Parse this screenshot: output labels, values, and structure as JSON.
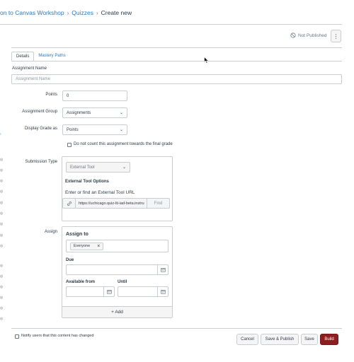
{
  "breadcrumb": {
    "course": "on to Canvas Workshop",
    "section": "Quizzes",
    "current": "Create new",
    "separator": "›"
  },
  "header": {
    "status": "Not Published",
    "menu_glyph": "⋮"
  },
  "tabs": [
    {
      "label": "Details",
      "active": true
    },
    {
      "label": "Mastery Paths",
      "active": false
    }
  ],
  "form": {
    "assignment_name_label": "Assignment Name",
    "assignment_name_placeholder": "Assignment Name",
    "points_label": "Points",
    "points_value": "0",
    "assignment_group_label": "Assignment Group",
    "assignment_group_value": "Assignments",
    "display_grade_label": "Display Grade as",
    "display_grade_value": "Points",
    "exclude_final_label": "Do not count this assignment towards the final grade",
    "submission_type_label": "Submission Type",
    "submission_type_value": "External Tool",
    "external_tool_options_heading": "External Tool Options",
    "external_tool_url_label": "Enter or find an External Tool URL",
    "external_tool_url_value": "https://uchicago.quiz-lti-iad-beta.instru",
    "find_button": "Find",
    "assign_label": "Assign",
    "assign_to_heading": "Assign to",
    "assignee_tag": "Everyone",
    "due_label": "Due",
    "available_from_label": "Available from",
    "until_label": "Until",
    "add_button": "+ Add"
  },
  "footer": {
    "notify_label": "Notify users that this content has changed",
    "cancel": "Cancel",
    "save_publish": "Save & Publish",
    "save": "Save",
    "build": "Build"
  },
  "colors": {
    "link": "#2b7abc",
    "primary_button": "#8b1e1e",
    "border": "#c7cdd1"
  }
}
